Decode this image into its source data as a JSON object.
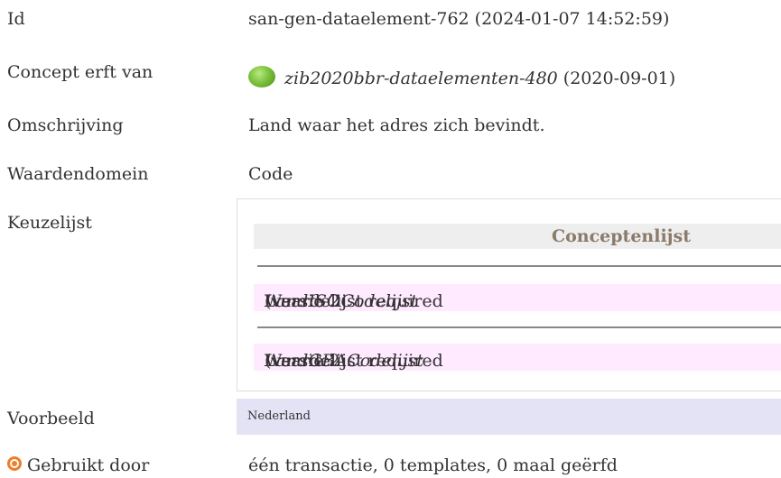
{
  "rows": {
    "id": {
      "label": "Id",
      "value": "san-gen-dataelement-762 (2024-01-07 14:52:59)"
    },
    "concept": {
      "label": "Concept erft van",
      "link": "zib2020bbr-dataelementen-480",
      "date": "(2020-09-01)",
      "icon": "green-circle-icon"
    },
    "omschrijving": {
      "label": "Omschrijving",
      "value": "Land waar het adres zich bevindt."
    },
    "waardendomein": {
      "label": "Waardendomein",
      "value": "Code"
    },
    "keuzelijst": {
      "label": "Keuzelijst",
      "header": "Conceptenlijst",
      "items": [
        {
          "prefix": "Waardelijst required",
          "name": "LandISOCodelijst",
          "suffix": "(versie 2"
        },
        {
          "prefix": "Waardelijst required",
          "name": "LandGBACodelijst",
          "suffix": "(versie 2"
        }
      ]
    },
    "voorbeeld": {
      "label": "Voorbeeld",
      "value": "Nederland"
    },
    "gebruikt": {
      "label": "Gebruikt door",
      "icon": "target-icon",
      "value": "één transactie, 0 templates, 0 maal geërfd"
    }
  },
  "colors": {
    "text": "#333333",
    "header_bg": "#eeeeee",
    "header_text": "#8a7a6a",
    "valueset_bg": "#ffeaff",
    "example_bg": "#e3e3f5",
    "icon_green": "#7cc23c",
    "icon_orange": "#f07d2a"
  }
}
